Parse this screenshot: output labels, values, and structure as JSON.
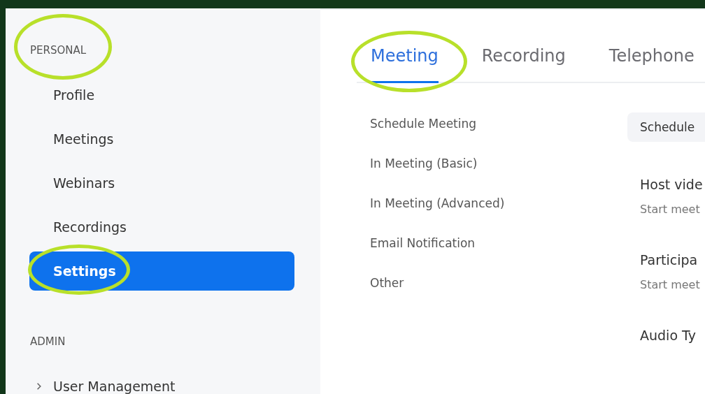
{
  "sidebar": {
    "sections": [
      {
        "label": "PERSONAL",
        "circled": true,
        "items": [
          {
            "label": "Profile",
            "selected": false,
            "circled": false
          },
          {
            "label": "Meetings",
            "selected": false,
            "circled": false
          },
          {
            "label": "Webinars",
            "selected": false,
            "circled": false
          },
          {
            "label": "Recordings",
            "selected": false,
            "circled": false
          },
          {
            "label": "Settings",
            "selected": true,
            "circled": true
          }
        ]
      },
      {
        "label": "ADMIN",
        "circled": false,
        "items": [
          {
            "label": "User Management",
            "selected": false,
            "circled": false,
            "expanded": false
          }
        ]
      }
    ]
  },
  "tabs": [
    {
      "label": "Meeting",
      "selected": true,
      "circled": true
    },
    {
      "label": "Recording",
      "selected": false,
      "circled": false
    },
    {
      "label": "Telephone",
      "selected": false,
      "circled": false
    }
  ],
  "section_nav": [
    "Schedule Meeting",
    "In Meeting (Basic)",
    "In Meeting (Advanced)",
    "Email Notification",
    "Other"
  ],
  "settings_panel": {
    "section_header": "Schedule",
    "settings": [
      {
        "title": "Host vide",
        "description": "Start meet"
      },
      {
        "title": "Participa",
        "description": "Start meet"
      },
      {
        "title": "Audio Ty"
      }
    ]
  }
}
